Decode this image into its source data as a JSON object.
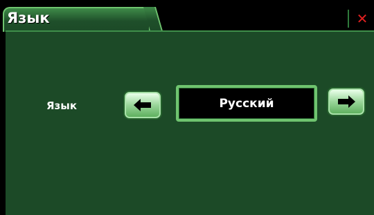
{
  "tab": {
    "title": "Язык"
  },
  "close": {
    "glyph": "✕"
  },
  "language": {
    "label": "Язык",
    "value": "Русский"
  },
  "icons": {
    "prev": "arrow-left-icon",
    "next": "arrow-right-icon"
  },
  "colors": {
    "panel": "#1c4a27",
    "accent": "#6fc46f",
    "close": "#e02020"
  }
}
